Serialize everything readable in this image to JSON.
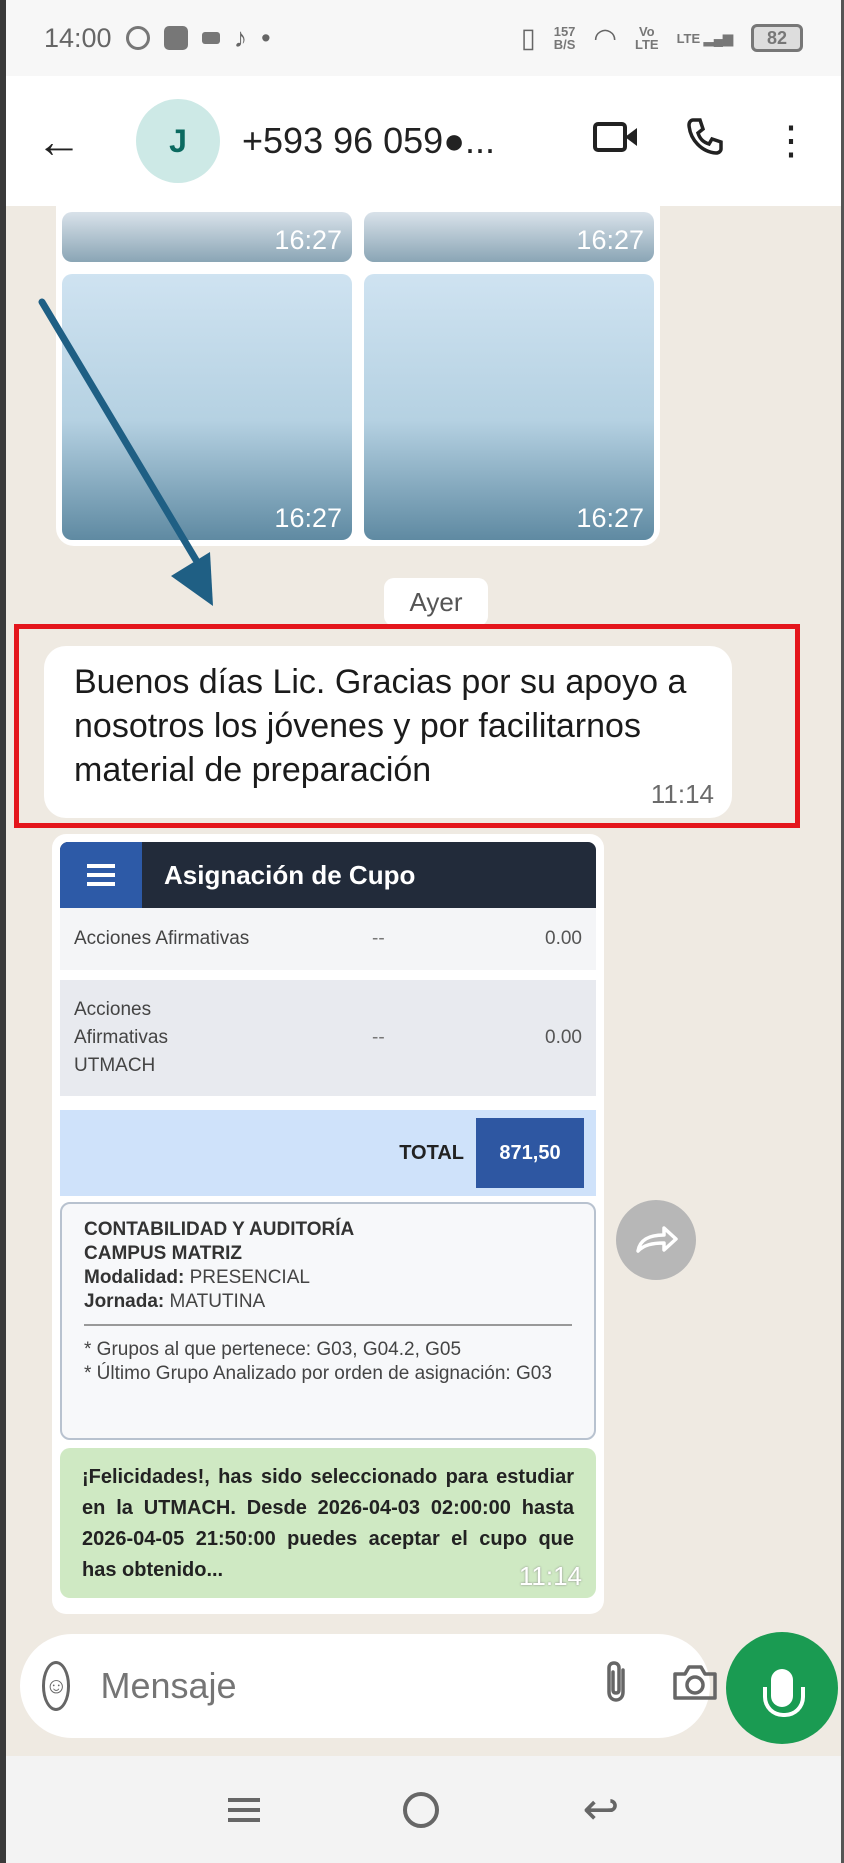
{
  "status_bar": {
    "time": "14:00",
    "data_speed_top": "157",
    "data_speed_bottom": "B/S",
    "volte_top": "Vo",
    "volte_bottom": "LTE",
    "network": "LTE",
    "battery": "82"
  },
  "header": {
    "avatar_letter": "J",
    "contact_name": "+593 96 059●..."
  },
  "media_grid": {
    "thumbnails": [
      {
        "time": "16:27"
      },
      {
        "time": "16:27"
      },
      {
        "time": "16:27"
      },
      {
        "time": "16:27"
      }
    ]
  },
  "date_separator": "Ayer",
  "text_message": {
    "text": "Buenos días Lic. Gracias por su apoyo a nosotros los jóvenes y por facilitarnos material de preparación",
    "time": "11:14"
  },
  "screenshot_message": {
    "title": "Asignación de Cupo",
    "rows": [
      {
        "label": "Acciones Afirmativas",
        "mid": "--",
        "value": "0.00"
      },
      {
        "label": "Acciones Afirmativas UTMACH",
        "mid": "--",
        "value": "0.00"
      }
    ],
    "total_label": "TOTAL",
    "total_value": "871,50",
    "program": {
      "career": "CONTABILIDAD Y AUDITORÍA",
      "campus": "CAMPUS MATRIZ",
      "modality_label": "Modalidad:",
      "modality_value": "PRESENCIAL",
      "shift_label": "Jornada:",
      "shift_value": "MATUTINA",
      "groups": "* Grupos al que pertenece: G03, G04.2, G05",
      "last_group": "* Último Grupo Analizado por orden de asignación: G03"
    },
    "congrats": "¡Felicidades!, has sido seleccionado para estudiar en la UTMACH. Desde 2026-04-03 02:00:00 hasta 2026-04-05 21:50:00 puedes aceptar el cupo que has obtenido...",
    "time": "11:14"
  },
  "input": {
    "placeholder": "Mensaje"
  },
  "colors": {
    "highlight": "#e4161c",
    "send_button": "#1a9b52",
    "arrow": "#1f5f84"
  }
}
